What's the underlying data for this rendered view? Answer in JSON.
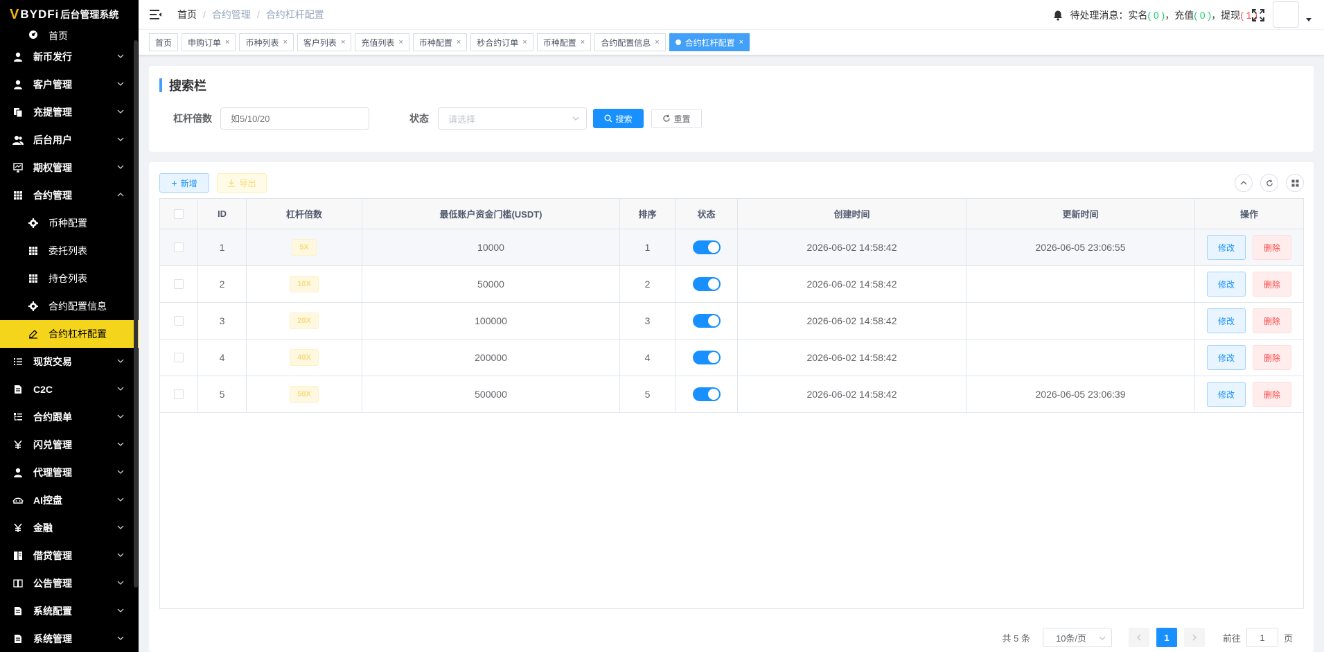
{
  "app": {
    "logo_mark": "V",
    "brand": "BYDFi",
    "title": "后台管理系统"
  },
  "sidebar": {
    "items": [
      {
        "label": "首页",
        "icon": "dashboard-icon",
        "type": "first"
      },
      {
        "label": "新币发行",
        "icon": "user-icon",
        "expandable": true
      },
      {
        "label": "客户管理",
        "icon": "user-icon",
        "expandable": true
      },
      {
        "label": "充提管理",
        "icon": "copy-icon",
        "expandable": true
      },
      {
        "label": "后台用户",
        "icon": "peoples-icon",
        "expandable": true
      },
      {
        "label": "期权管理",
        "icon": "monitor-icon",
        "expandable": true
      },
      {
        "label": "合约管理",
        "icon": "table-icon",
        "expandable": true,
        "expanded": true
      },
      {
        "label": "币种配置",
        "icon": "gear-icon",
        "type": "sub"
      },
      {
        "label": "委托列表",
        "icon": "table-icon",
        "type": "sub"
      },
      {
        "label": "持仓列表",
        "icon": "table-icon",
        "type": "sub"
      },
      {
        "label": "合约配置信息",
        "icon": "gear-icon",
        "type": "sub"
      },
      {
        "label": "合约杠杆配置",
        "icon": "edit-icon",
        "type": "sub",
        "active": true
      },
      {
        "label": "现货交易",
        "icon": "list-icon",
        "expandable": true
      },
      {
        "label": "C2C",
        "icon": "document-icon",
        "expandable": true
      },
      {
        "label": "合约跟单",
        "icon": "tree-icon",
        "expandable": true
      },
      {
        "label": "闪兑管理",
        "icon": "yen-icon",
        "expandable": true
      },
      {
        "label": "代理管理",
        "icon": "user-icon",
        "expandable": true
      },
      {
        "label": "AI控盘",
        "icon": "robot-icon",
        "expandable": true
      },
      {
        "label": "金融",
        "icon": "yen-icon",
        "expandable": true
      },
      {
        "label": "借贷管理",
        "icon": "book-icon",
        "expandable": true
      },
      {
        "label": "公告管理",
        "icon": "book-open-icon",
        "expandable": true
      },
      {
        "label": "系统配置",
        "icon": "document-icon",
        "expandable": true
      },
      {
        "label": "系统管理",
        "icon": "document-icon",
        "expandable": true
      }
    ]
  },
  "header": {
    "breadcrumb": [
      "首页",
      "合约管理",
      "合约杠杆配置"
    ],
    "notice_prefix": "待处理消息：",
    "notice_realname": "实名",
    "notice_realname_count": "( 0 )",
    "notice_recharge": "充值",
    "notice_recharge_count": "( 0 )",
    "notice_withdraw": "提现",
    "notice_withdraw_count": "( 1 )",
    "comma": "，"
  },
  "tabs": [
    {
      "label": "首页",
      "closable": false
    },
    {
      "label": "申购订单",
      "closable": true
    },
    {
      "label": "币种列表",
      "closable": true
    },
    {
      "label": "客户列表",
      "closable": true
    },
    {
      "label": "充值列表",
      "closable": true
    },
    {
      "label": "币种配置",
      "closable": true
    },
    {
      "label": "秒合约订单",
      "closable": true
    },
    {
      "label": "币种配置",
      "closable": true
    },
    {
      "label": "合约配置信息",
      "closable": true
    },
    {
      "label": "合约杠杆配置",
      "closable": true,
      "active": true
    }
  ],
  "search": {
    "title": "搜索栏",
    "leverage_label": "杠杆倍数",
    "leverage_placeholder": "如5/10/20",
    "status_label": "状态",
    "status_placeholder": "请选择",
    "search_btn": "搜索",
    "reset_btn": "重置"
  },
  "toolbar": {
    "add_btn": "新增",
    "export_btn": "导出"
  },
  "table": {
    "headers": [
      "ID",
      "杠杆倍数",
      "最低账户资金门槛(USDT)",
      "排序",
      "状态",
      "创建时间",
      "更新时间",
      "操作"
    ],
    "edit_label": "修改",
    "delete_label": "删除",
    "rows": [
      {
        "id": "1",
        "leverage": "5X",
        "min_fund": "10000",
        "sort": "1",
        "enabled": true,
        "created": "2026-06-02 14:58:42",
        "updated": "2026-06-05 23:06:55"
      },
      {
        "id": "2",
        "leverage": "10X",
        "min_fund": "50000",
        "sort": "2",
        "enabled": true,
        "created": "2026-06-02 14:58:42",
        "updated": ""
      },
      {
        "id": "3",
        "leverage": "20X",
        "min_fund": "100000",
        "sort": "3",
        "enabled": true,
        "created": "2026-06-02 14:58:42",
        "updated": ""
      },
      {
        "id": "4",
        "leverage": "40X",
        "min_fund": "200000",
        "sort": "4",
        "enabled": true,
        "created": "2026-06-02 14:58:42",
        "updated": ""
      },
      {
        "id": "5",
        "leverage": "50X",
        "min_fund": "500000",
        "sort": "5",
        "enabled": true,
        "created": "2026-06-02 14:58:42",
        "updated": "2026-06-05 23:06:39"
      }
    ]
  },
  "pagination": {
    "total": "共 5 条",
    "page_size": "10条/页",
    "current_page": "1",
    "goto_prefix": "前往",
    "goto_value": "1",
    "goto_suffix": "页"
  },
  "colors": {
    "sidebar_bg": "#000000",
    "active_menu": "#f5d51c",
    "primary": "#1890ff",
    "danger": "#ff4949",
    "success": "#13ce66"
  }
}
